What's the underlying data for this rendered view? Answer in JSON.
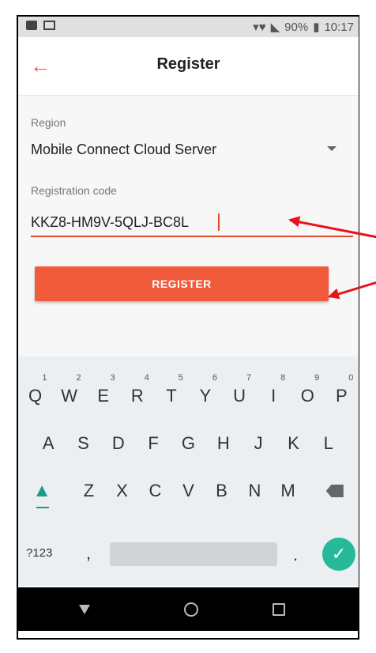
{
  "status_bar": {
    "battery": "90%",
    "time": "10:17"
  },
  "app_bar": {
    "title": "Register",
    "back_icon": "arrow-left-icon"
  },
  "form": {
    "region_label": "Region",
    "region_value": "Mobile Connect Cloud Server",
    "code_label": "Registration code",
    "code_value": "KKZ8-HM9V-5QLJ-BC8L",
    "register_label": "REGISTER"
  },
  "keyboard": {
    "row1": [
      {
        "key": "Q",
        "hint": "1"
      },
      {
        "key": "W",
        "hint": "2"
      },
      {
        "key": "E",
        "hint": "3"
      },
      {
        "key": "R",
        "hint": "4"
      },
      {
        "key": "T",
        "hint": "5"
      },
      {
        "key": "Y",
        "hint": "6"
      },
      {
        "key": "U",
        "hint": "7"
      },
      {
        "key": "I",
        "hint": "8"
      },
      {
        "key": "O",
        "hint": "9"
      },
      {
        "key": "P",
        "hint": "0"
      }
    ],
    "row2": [
      "A",
      "S",
      "D",
      "F",
      "G",
      "H",
      "J",
      "K",
      "L"
    ],
    "row3": [
      "Z",
      "X",
      "C",
      "V",
      "B",
      "N",
      "M"
    ],
    "mode_key": "?123",
    "comma": ",",
    "period": "."
  },
  "colors": {
    "accent": "#f15a3a",
    "enter": "#26b99a",
    "annotation": "#e8121b"
  }
}
